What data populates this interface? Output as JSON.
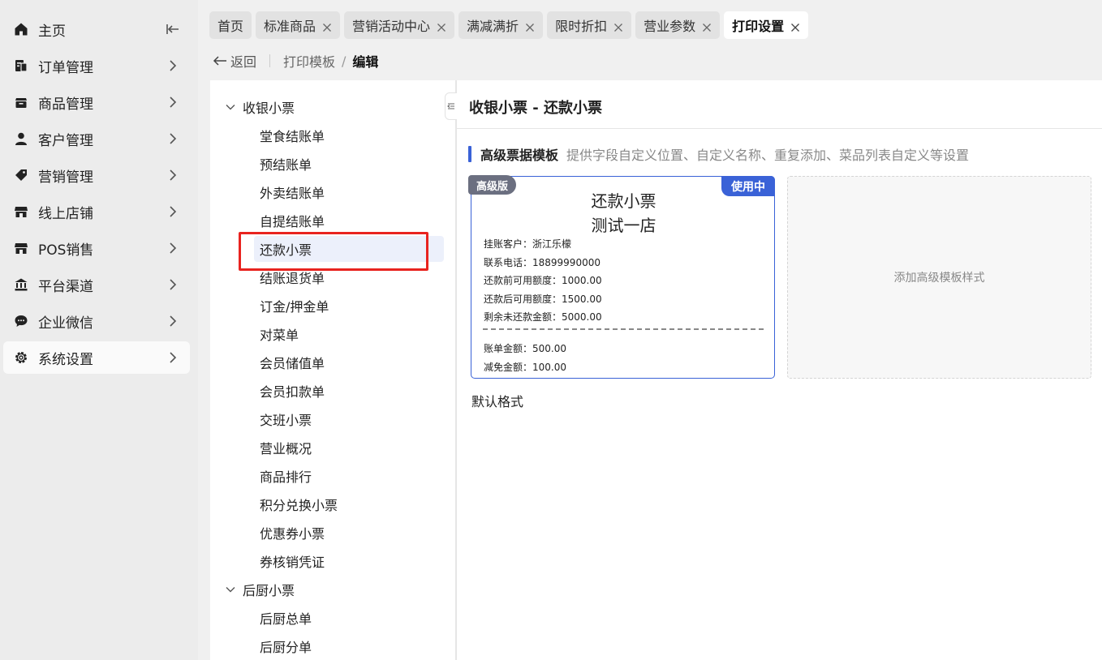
{
  "sidebar": {
    "items": [
      {
        "label": "主页",
        "icon": "home-icon",
        "right": "collapse-icon"
      },
      {
        "label": "订单管理",
        "icon": "order-icon",
        "right": "chevron-right-icon"
      },
      {
        "label": "商品管理",
        "icon": "product-icon",
        "right": "chevron-right-icon"
      },
      {
        "label": "客户管理",
        "icon": "user-icon",
        "right": "chevron-right-icon"
      },
      {
        "label": "营销管理",
        "icon": "tag-icon",
        "right": "chevron-right-icon"
      },
      {
        "label": "线上店铺",
        "icon": "store-icon",
        "right": "chevron-right-icon"
      },
      {
        "label": "POS销售",
        "icon": "store-icon",
        "right": "chevron-right-icon"
      },
      {
        "label": "平台渠道",
        "icon": "bank-icon",
        "right": "chevron-right-icon"
      },
      {
        "label": "企业微信",
        "icon": "chat-icon",
        "right": "chevron-right-icon"
      },
      {
        "label": "系统设置",
        "icon": "gear-icon",
        "right": "chevron-right-icon",
        "active": true
      }
    ]
  },
  "tabs": [
    {
      "label": "首页",
      "closable": false
    },
    {
      "label": "标准商品",
      "closable": true
    },
    {
      "label": "营销活动中心",
      "closable": true
    },
    {
      "label": "满减满折",
      "closable": true
    },
    {
      "label": "限时折扣",
      "closable": true
    },
    {
      "label": "营业参数",
      "closable": true
    },
    {
      "label": "打印设置",
      "closable": true,
      "active": true
    }
  ],
  "breadcrumb": {
    "back": "返回",
    "parent": "打印模板",
    "separator": "/",
    "current": "编辑"
  },
  "tree": {
    "groups": [
      {
        "label": "收银小票",
        "items": [
          "堂食结账单",
          "预结账单",
          "外卖结账单",
          "自提结账单",
          "还款小票",
          "结账退货单",
          "订金/押金单",
          "对菜单",
          "会员储值单",
          "会员扣款单",
          "交班小票",
          "营业概况",
          "商品排行",
          "积分兑换小票",
          "优惠券小票",
          "券核销凭证"
        ]
      },
      {
        "label": "后厨小票",
        "items": [
          "后厨总单",
          "后厨分单"
        ]
      }
    ],
    "selected": "还款小票"
  },
  "main": {
    "title": "收银小票 - 还款小票",
    "section_title": "高级票据模板",
    "section_desc": "提供字段自定义位置、自定义名称、重复添加、菜品列表自定义等设置",
    "card": {
      "badge_pro": "高级版",
      "badge_in_use": "使用中",
      "title1": "还款小票",
      "title2": "测试一店",
      "lines": [
        "挂账客户：浙江乐檬",
        "联系电话：18899990000",
        "还款前可用额度：1000.00",
        "还款后可用额度：1500.00",
        "剩余未还款金额：5000.00"
      ],
      "lines2": [
        "账单金额：500.00",
        "减免金额：100.00"
      ]
    },
    "add_template": "添加高级模板样式",
    "default_format": "默认格式"
  },
  "colors": {
    "accent": "#3a62d7",
    "highlight": "#e8231f",
    "badge_gray": "#6b6f80"
  }
}
